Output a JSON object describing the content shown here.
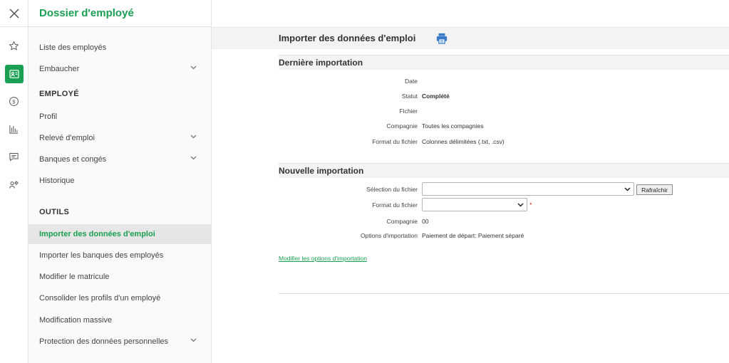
{
  "rail": {
    "icons": [
      "close-icon",
      "star-icon",
      "employee-file-icon",
      "dollar-icon",
      "chart-icon",
      "message-icon",
      "users-settings-icon"
    ]
  },
  "nav": {
    "title": "Dossier d'employé",
    "items_top": [
      {
        "label": "Liste des employés"
      },
      {
        "label": "Embaucher"
      }
    ],
    "section_employe": "EMPLOYÉ",
    "items_employe": [
      {
        "label": "Profil"
      },
      {
        "label": "Relevé d'emploi"
      },
      {
        "label": "Banques et congés"
      },
      {
        "label": "Historique"
      }
    ],
    "section_outils": "OUTILS",
    "items_outils": [
      {
        "label": "Importer des données d'emploi"
      },
      {
        "label": "Importer les banques des employés"
      },
      {
        "label": "Modifier le matricule"
      },
      {
        "label": "Consolider les profils d'un employé"
      },
      {
        "label": "Modification massive"
      },
      {
        "label": "Protection des données personnelles"
      }
    ]
  },
  "main": {
    "title": "Importer des données d'emploi",
    "last_import": {
      "heading": "Dernière importation",
      "date_label": "Date",
      "date_value": "",
      "status_label": "Statut",
      "status_value": "Complété",
      "file_label": "Fichier",
      "file_value": "",
      "company_label": "Compagnie",
      "company_value": "Toutes les compagnies",
      "format_label": "Format du fichier",
      "format_value": "Colonnes délimitées (.txt, .csv)"
    },
    "new_import": {
      "heading": "Nouvelle importation",
      "file_select_label": "Sélection du fichier",
      "file_select_value": "",
      "refresh_label": "Rafraîchir",
      "format_label": "Format du fichier",
      "format_value": "",
      "required_marker": "*",
      "company_label": "Compagnie",
      "company_value": "00",
      "options_label": "Options d'importation",
      "options_value": "Paiement de départ: Paiement séparé",
      "modify_link": "Modifier les options d'importation"
    }
  },
  "colors": {
    "accent": "#1aa052",
    "required": "#d21e1e",
    "print_icon": "#3a7bc8"
  }
}
